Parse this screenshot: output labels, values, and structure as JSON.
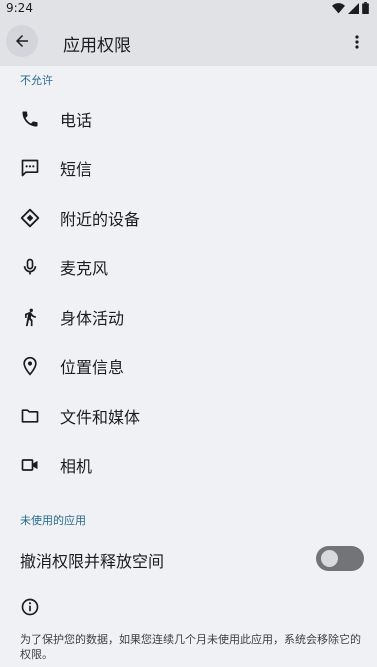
{
  "status_bar": {
    "time": "9:24"
  },
  "app_bar": {
    "title": "应用权限",
    "back_icon": "arrow-left-icon",
    "more_icon": "more-vertical-icon"
  },
  "sections": {
    "not_allowed": "不允许",
    "unused_apps": "未使用的应用"
  },
  "permissions": [
    {
      "label": "电话",
      "icon": "phone-icon"
    },
    {
      "label": "短信",
      "icon": "sms-icon"
    },
    {
      "label": "附近的设备",
      "icon": "nearby-devices-icon"
    },
    {
      "label": "麦克风",
      "icon": "microphone-icon"
    },
    {
      "label": "身体活动",
      "icon": "walking-icon"
    },
    {
      "label": "位置信息",
      "icon": "location-pin-icon"
    },
    {
      "label": "文件和媒体",
      "icon": "folder-icon"
    },
    {
      "label": "相机",
      "icon": "camera-icon"
    }
  ],
  "unused": {
    "toggle_label": "撤消权限并释放空间",
    "toggle_on": false,
    "info_icon": "info-icon",
    "info_text": "为了保护您的数据，如果您连续几个月未使用此应用，系统会移除它的权限。"
  },
  "colors": {
    "accent": "#2a6a8c",
    "background": "#eff1f5",
    "appbar": "#e0e2e6"
  }
}
